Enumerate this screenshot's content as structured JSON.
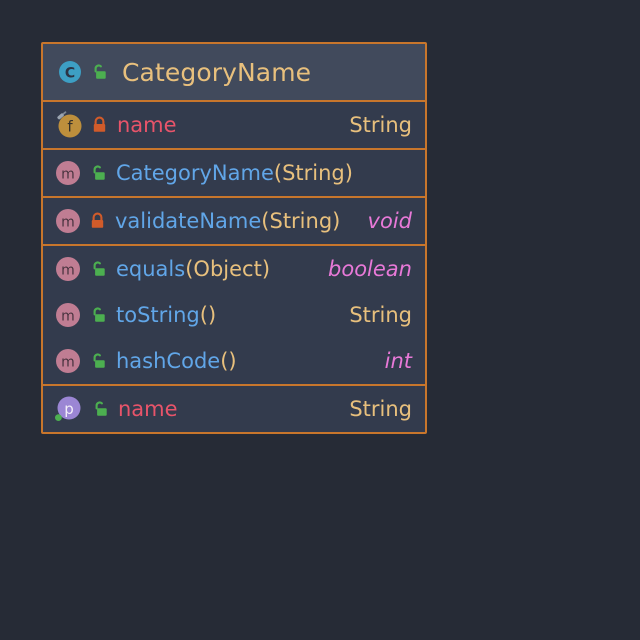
{
  "class_box": {
    "header": {
      "name": "CategoryName",
      "kind_icon": "class-icon",
      "kind_letter": "C",
      "visibility_icon": "padlock-open-icon",
      "visibility": "public"
    },
    "sections": [
      {
        "kind": "fields",
        "members": [
          {
            "icon": "field-icon",
            "icon_letter": "f",
            "visibility_icon": "padlock-closed-icon",
            "visibility": "private",
            "name": "name",
            "params": "",
            "open_paren": "",
            "close_paren": "",
            "return_type": "String",
            "return_kind": "class"
          }
        ]
      },
      {
        "kind": "constructors",
        "members": [
          {
            "icon": "method-icon",
            "icon_letter": "m",
            "visibility_icon": "padlock-open-icon",
            "visibility": "public",
            "name": "CategoryName",
            "open_paren": "(",
            "params": "String",
            "close_paren": ")",
            "return_type": "",
            "return_kind": ""
          }
        ]
      },
      {
        "kind": "private-methods",
        "members": [
          {
            "icon": "method-icon",
            "icon_letter": "m",
            "visibility_icon": "padlock-closed-icon",
            "visibility": "private",
            "name": "validateName",
            "open_paren": "(",
            "params": "String",
            "close_paren": ")",
            "return_type": "void",
            "return_kind": "primitive"
          }
        ]
      },
      {
        "kind": "public-methods",
        "members": [
          {
            "icon": "method-icon",
            "icon_letter": "m",
            "visibility_icon": "padlock-open-icon",
            "visibility": "public",
            "name": "equals",
            "open_paren": "(",
            "params": "Object",
            "close_paren": ")",
            "return_type": "boolean",
            "return_kind": "primitive"
          },
          {
            "icon": "method-icon",
            "icon_letter": "m",
            "visibility_icon": "padlock-open-icon",
            "visibility": "public",
            "name": "toString",
            "open_paren": "(",
            "params": "",
            "close_paren": ")",
            "return_type": "String",
            "return_kind": "class"
          },
          {
            "icon": "method-icon",
            "icon_letter": "m",
            "visibility_icon": "padlock-open-icon",
            "visibility": "public",
            "name": "hashCode",
            "open_paren": "(",
            "params": "",
            "close_paren": ")",
            "return_type": "int",
            "return_kind": "primitive"
          }
        ]
      },
      {
        "kind": "properties",
        "members": [
          {
            "icon": "property-icon",
            "icon_letter": "p",
            "visibility_icon": "padlock-open-icon",
            "visibility": "public",
            "name": "name",
            "open_paren": "",
            "params": "",
            "close_paren": "",
            "return_type": "String",
            "return_kind": "class"
          }
        ]
      }
    ]
  },
  "colors": {
    "page_background": "#262b36",
    "row_background": "#333b4d",
    "header_background": "#414a5c",
    "border": "#c8762c",
    "class_name": "#e8c07d",
    "field_name": "#e8546a",
    "method_name": "#61a6e8",
    "param_type": "#e8c07d",
    "primitive_type": "#e879d8",
    "class_icon": "#3d9fc4",
    "field_icon": "#bd8f3c",
    "method_icon": "#c07d93",
    "property_icon": "#9b86d4",
    "lock_public": "#4caf50",
    "lock_private": "#d15b2a"
  }
}
